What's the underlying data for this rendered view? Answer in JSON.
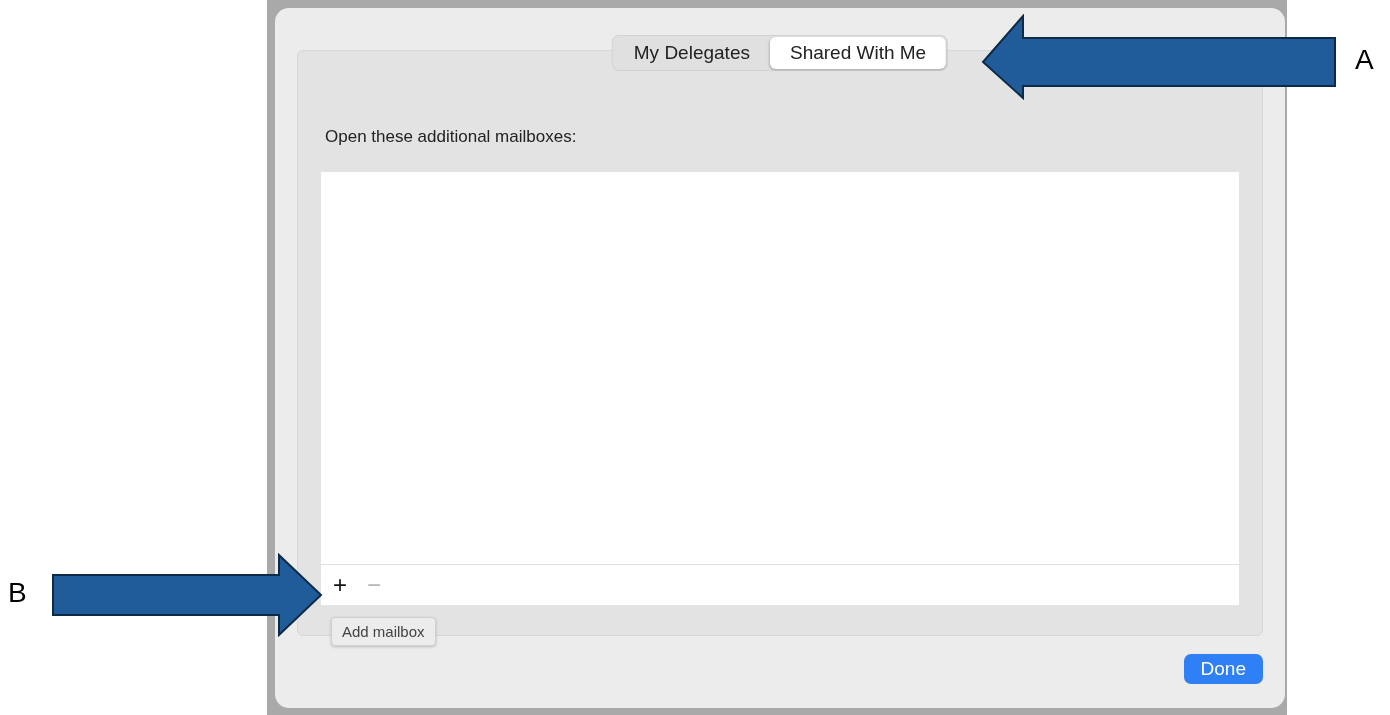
{
  "tabs": [
    {
      "label": "My Delegates",
      "selected": false
    },
    {
      "label": "Shared With Me",
      "selected": true
    }
  ],
  "prompt": "Open these additional mailboxes:",
  "list_toolbar": [
    {
      "label": "+",
      "disabled": false
    },
    {
      "label": "−",
      "disabled": true
    }
  ],
  "tooltip": "Add mailbox",
  "done_button": "Done",
  "annotations": [
    {
      "label": "A",
      "kind": "left"
    },
    {
      "label": "B",
      "kind": "right"
    }
  ]
}
